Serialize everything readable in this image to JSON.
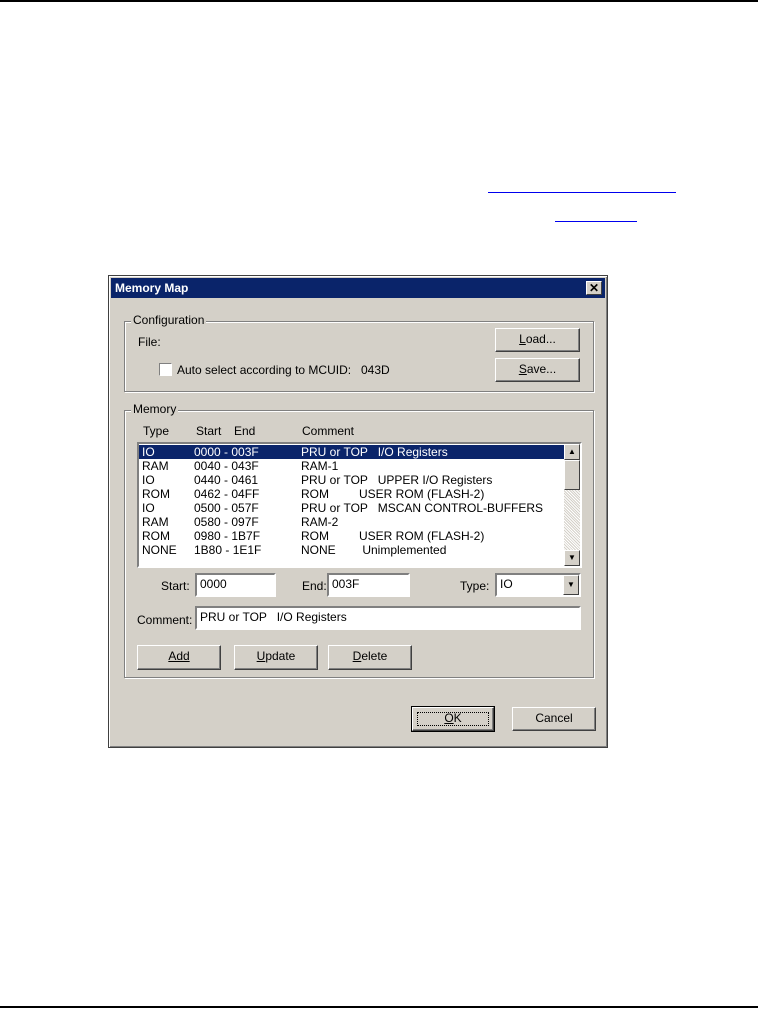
{
  "dialog": {
    "title": "Memory Map",
    "close_icon": "close-icon"
  },
  "configuration": {
    "group_label": "Configuration",
    "file_label": "File:",
    "load_button": "Load...",
    "save_button": "Save...",
    "auto_select_label": "Auto select according to MCUID:",
    "auto_select_checked": false,
    "mcuid_value": "043D"
  },
  "memory": {
    "group_label": "Memory",
    "columns": {
      "type": "Type",
      "start": "Start",
      "end": "End",
      "comment": "Comment"
    },
    "rows": [
      {
        "type": "IO",
        "range": "0000 - 003F",
        "comment": "PRU or TOP   I/O Registers",
        "selected": true
      },
      {
        "type": "RAM",
        "range": "0040 - 043F",
        "comment": "RAM-1"
      },
      {
        "type": "IO",
        "range": "0440 - 0461",
        "comment": "PRU or TOP   UPPER I/O Registers"
      },
      {
        "type": "ROM",
        "range": "0462 - 04FF",
        "comment": "ROM         USER ROM (FLASH-2)"
      },
      {
        "type": "IO",
        "range": "0500 - 057F",
        "comment": "PRU or TOP   MSCAN CONTROL-BUFFERS"
      },
      {
        "type": "RAM",
        "range": "0580 - 097F",
        "comment": "RAM-2"
      },
      {
        "type": "ROM",
        "range": "0980 - 1B7F",
        "comment": "ROM         USER ROM (FLASH-2)"
      },
      {
        "type": "NONE",
        "range": "1B80 - 1E1F",
        "comment": "NONE        Unimplemented"
      }
    ],
    "start_label": "Start:",
    "start_value": "0000",
    "end_label": "End:",
    "end_value": "003F",
    "type_label": "Type:",
    "type_value": "IO",
    "comment_label": "Comment:",
    "comment_value": "PRU or TOP   I/O Registers",
    "add_button": "Add",
    "update_button": "Update",
    "delete_button": "Delete"
  },
  "footer": {
    "ok_button": "OK",
    "cancel_button": "Cancel"
  }
}
